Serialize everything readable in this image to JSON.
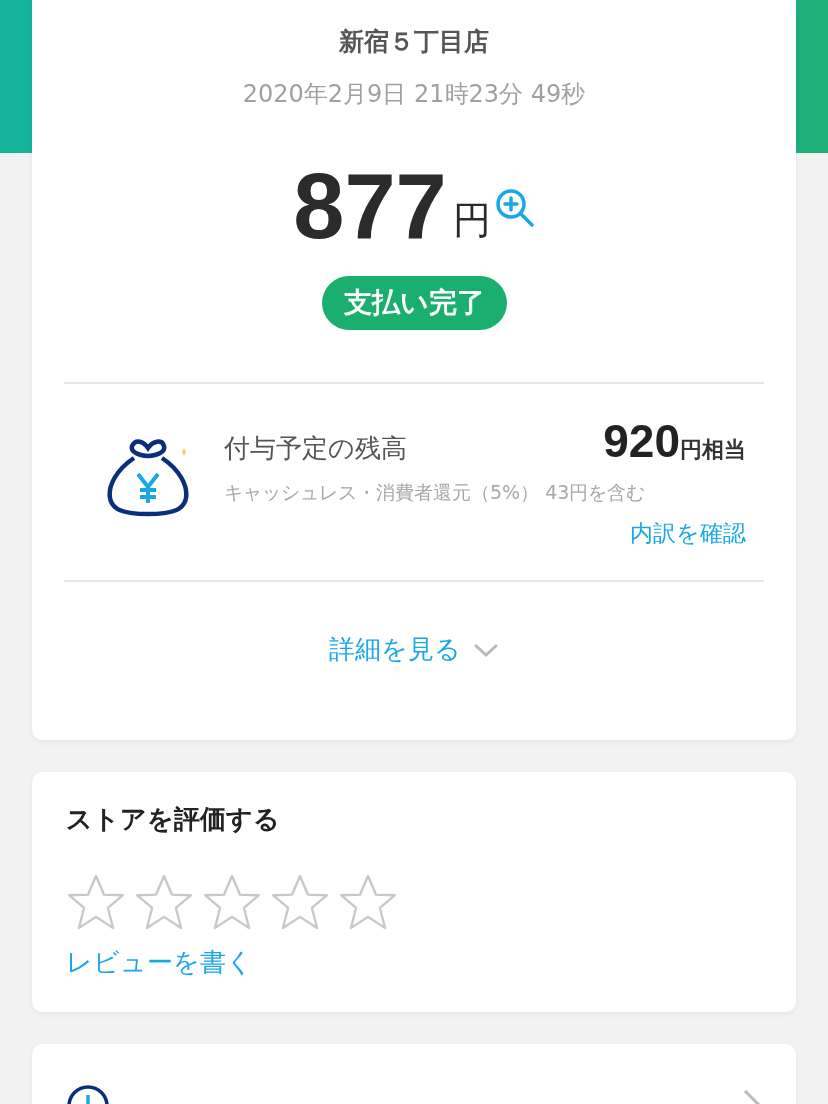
{
  "receipt": {
    "store": "新宿５丁目店",
    "datetime": "2020年2月9日 21時23分 49秒",
    "amount": "877",
    "currency": "円",
    "status": "支払い完了"
  },
  "points": {
    "label": "付与予定の残高",
    "value": "920",
    "unit": "円相当",
    "note": "キャッシュレス・消費者還元（5%） 43円を含む",
    "link": "内訳を確認"
  },
  "details_link": "詳細を見る",
  "rating": {
    "title": "ストアを評価する",
    "stars": 0,
    "review_link": "レビューを書く"
  }
}
